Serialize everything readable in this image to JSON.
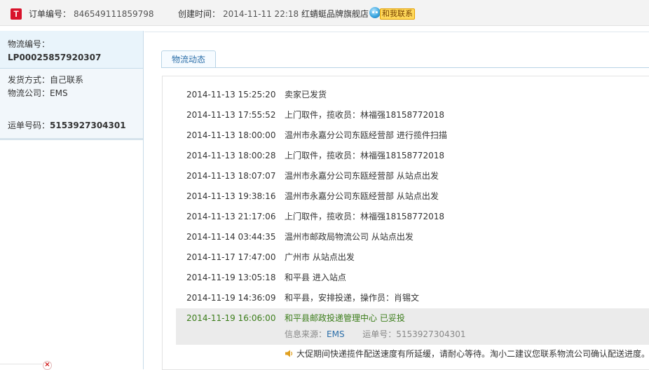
{
  "header": {
    "order_label": "订单编号：",
    "order_no": "846549111859798",
    "created_label": "创建时间：",
    "created_at": "2014-11-11 22:18",
    "shop_name": "红蜻蜓品牌旗舰店",
    "contact_label": "和我联系",
    "logo_char": "T"
  },
  "sidebar": {
    "logistics_no_label": "物流编号：",
    "logistics_no": "LP00025857920307",
    "ship_method_label": "发货方式：",
    "ship_method": "自己联系",
    "company_label": "物流公司：",
    "company": "EMS",
    "waybill_label": "运单号码：",
    "waybill": "5153927304301",
    "close_char": "×"
  },
  "tab": {
    "label": "物流动态"
  },
  "tracking": [
    {
      "time": "2014-11-13 15:25:20",
      "desc": "卖家已发货"
    },
    {
      "time": "2014-11-13 17:55:52",
      "desc": "上门取件，揽收员：林福强18158772018"
    },
    {
      "time": "2014-11-13 18:00:00",
      "desc": "温州市永嘉分公司东瓯经营部 进行揽件扫描"
    },
    {
      "time": "2014-11-13 18:00:28",
      "desc": "上门取件，揽收员：林福强18158772018"
    },
    {
      "time": "2014-11-13 18:07:07",
      "desc": "温州市永嘉分公司东瓯经营部 从站点出发"
    },
    {
      "time": "2014-11-13 19:38:16",
      "desc": "温州市永嘉分公司东瓯经营部 从站点出发"
    },
    {
      "time": "2014-11-13 21:17:06",
      "desc": "上门取件，揽收员：林福强18158772018"
    },
    {
      "time": "2014-11-14 03:44:35",
      "desc": "温州市邮政局物流公司 从站点出发"
    },
    {
      "time": "2014-11-17 17:47:00",
      "desc": "广州市 从站点出发"
    },
    {
      "time": "2014-11-19 13:05:18",
      "desc": "和平县 进入站点"
    },
    {
      "time": "2014-11-19 14:36:09",
      "desc": "和平县，安排投递，操作员：肖锡文"
    },
    {
      "time": "2014-11-19 16:06:00",
      "desc": "和平县邮政投递管理中心 已妥投"
    }
  ],
  "source": {
    "source_label": "信息来源：",
    "source_value": "EMS",
    "waybill_label": "运单号：",
    "waybill_value": "5153927304301"
  },
  "notice": "大促期间快递揽件配送速度有所延缓，请耐心等待。淘小二建议您联系物流公司确认配送进度。",
  "colors": {
    "latest_status": "#3b7d1a",
    "link": "#2b6ea8",
    "brand": "#d8132b"
  },
  "icons": [
    "tmall-logo",
    "wangwang-icon",
    "speaker-icon",
    "close-icon"
  ]
}
